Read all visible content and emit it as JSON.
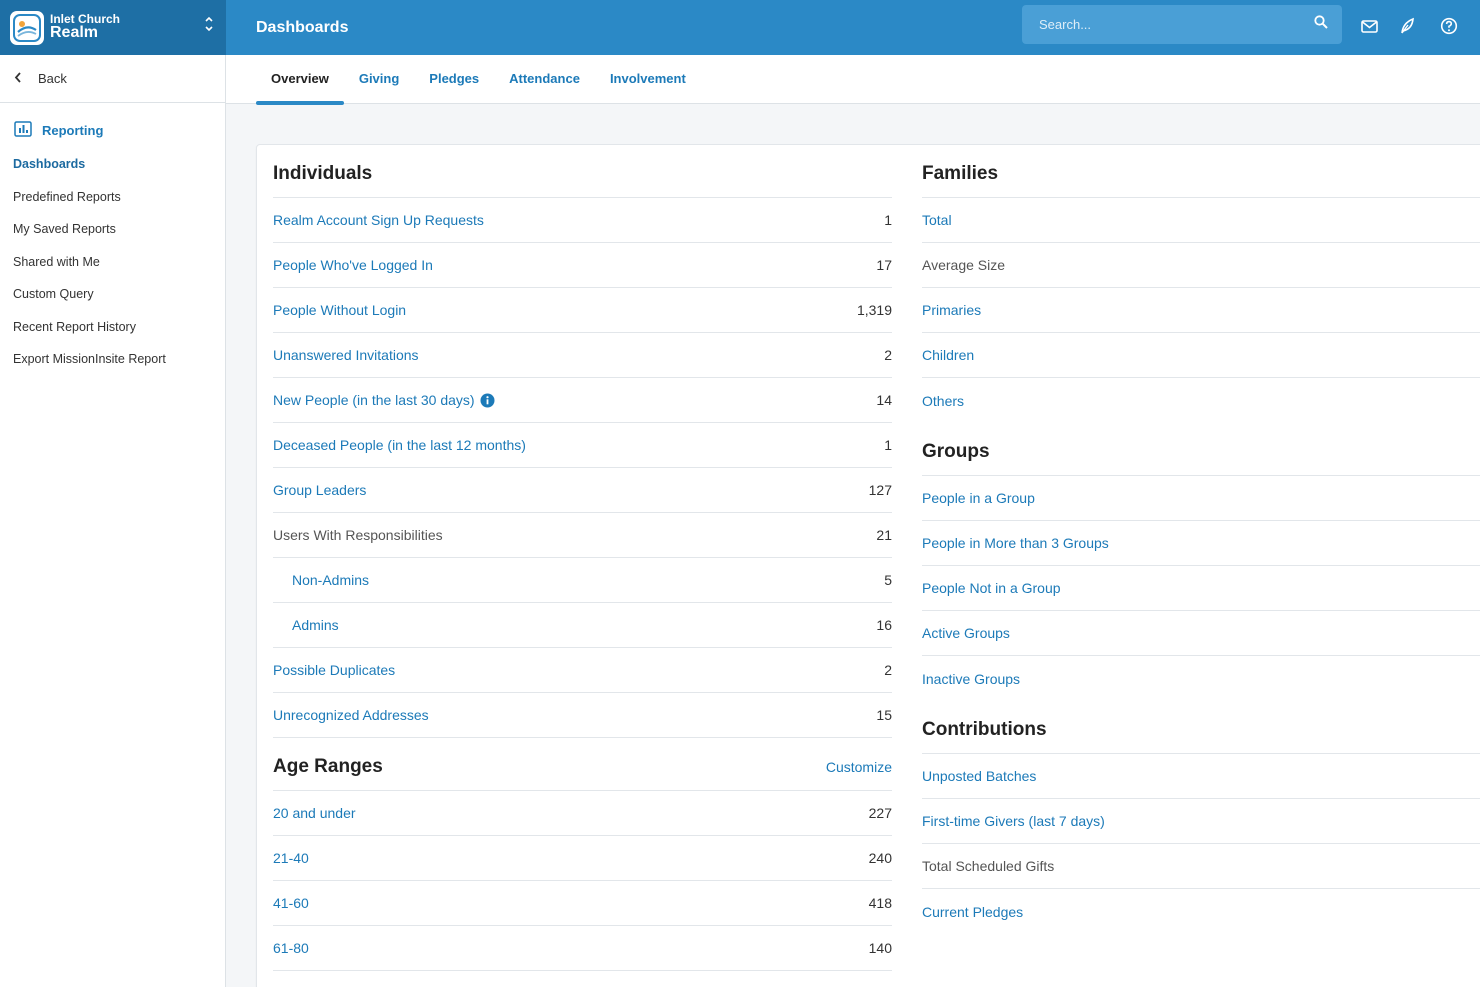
{
  "brand": {
    "org": "Inlet Church",
    "app": "Realm"
  },
  "header": {
    "title": "Dashboards",
    "search_placeholder": "Search..."
  },
  "colors": {
    "topbar": "#2b89c6",
    "brand_bg": "#1e6fa5",
    "link": "#1c7ab8"
  },
  "icons": {
    "mail": "mail-icon",
    "feedback": "leaf-icon",
    "help": "help-icon",
    "search": "search-icon"
  },
  "sidebar": {
    "back": "Back",
    "section": "Reporting",
    "items": [
      {
        "label": "Dashboards",
        "active": true
      },
      {
        "label": "Predefined Reports"
      },
      {
        "label": "My Saved Reports"
      },
      {
        "label": "Shared with Me"
      },
      {
        "label": "Custom Query"
      },
      {
        "label": "Recent Report History"
      },
      {
        "label": "Export MissionInsite Report"
      }
    ]
  },
  "tabs": [
    "Overview",
    "Giving",
    "Pledges",
    "Attendance",
    "Involvement"
  ],
  "individuals": {
    "title": "Individuals",
    "rows": [
      {
        "label": "Realm Account Sign Up Requests",
        "value": "1"
      },
      {
        "label": "People Who've Logged In",
        "value": "17"
      },
      {
        "label": "People Without Login",
        "value": "1,319"
      },
      {
        "label": "Unanswered Invitations",
        "value": "2"
      },
      {
        "label": "New People (in the last 30 days)",
        "value": "14"
      },
      {
        "label": "Deceased People (in the last 12 months)",
        "value": "1"
      },
      {
        "label": "Group Leaders",
        "value": "127"
      },
      {
        "label": "Users With Responsibilities",
        "value": "21"
      },
      {
        "label": "Non-Admins",
        "value": "5"
      },
      {
        "label": "Admins",
        "value": "16"
      },
      {
        "label": "Possible Duplicates",
        "value": "2"
      },
      {
        "label": "Unrecognized Addresses",
        "value": "15"
      }
    ]
  },
  "age_ranges": {
    "title": "Age Ranges",
    "customize": "Customize",
    "rows": [
      {
        "label": "20 and under",
        "value": "227"
      },
      {
        "label": "21-40",
        "value": "240"
      },
      {
        "label": "41-60",
        "value": "418"
      },
      {
        "label": "61-80",
        "value": "140"
      }
    ]
  },
  "families": {
    "title": "Families",
    "rows": [
      "Total",
      "Average Size",
      "Primaries",
      "Children",
      "Others"
    ]
  },
  "groups": {
    "title": "Groups",
    "rows": [
      "People in a Group",
      "People in More than 3 Groups",
      "People Not in a Group",
      "Active Groups",
      "Inactive Groups"
    ]
  },
  "contributions": {
    "title": "Contributions",
    "rows": [
      "Unposted Batches",
      "First-time Givers (last 7 days)",
      "Total Scheduled Gifts",
      "Current Pledges"
    ]
  }
}
